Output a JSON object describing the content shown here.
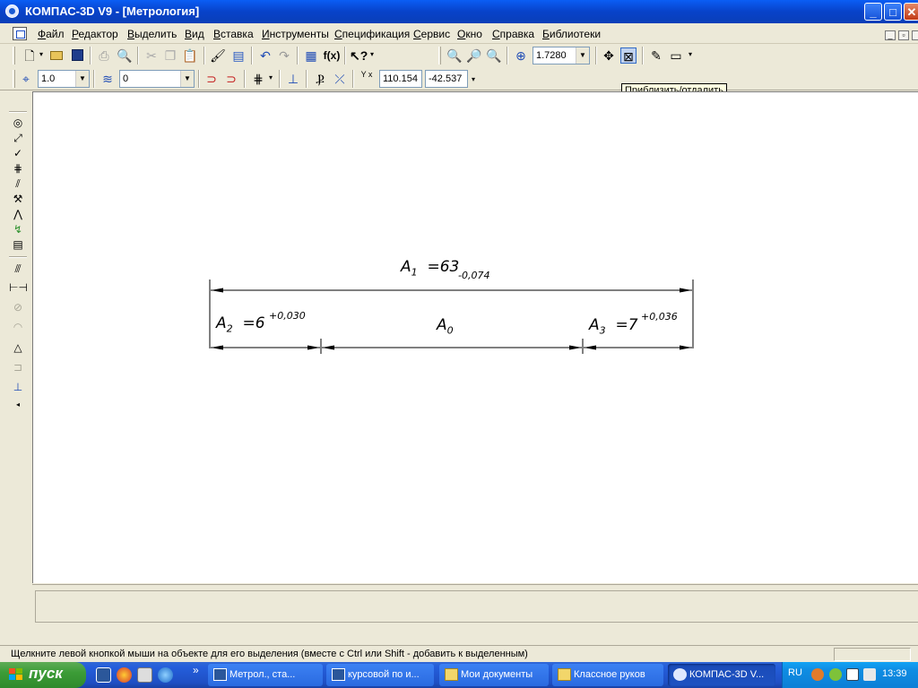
{
  "window": {
    "title": "КОМПАС-3D V9 - [Метрология]",
    "buttons": {
      "minimize": "_",
      "maximize": "□",
      "close": "✕"
    }
  },
  "menu": {
    "items": [
      "Файл",
      "Редактор",
      "Выделить",
      "Вид",
      "Вставка",
      "Инструменты",
      "Спецификация",
      "Сервис",
      "Окно",
      "Справка",
      "Библиотеки"
    ],
    "mdi": {
      "minimize": "_",
      "restore": "▫"
    }
  },
  "toolbar1": {
    "icons": [
      "new-document-icon",
      "open-icon",
      "save-icon",
      "print-icon",
      "print-preview-icon",
      "cut-icon",
      "copy-icon",
      "paste-icon",
      "properties-brush-icon",
      "manager-icon",
      "undo-icon",
      "redo-icon",
      "variables-icon",
      "function-icon",
      "help-pointer-icon",
      "zoom-in-icon",
      "zoom-box-icon",
      "zoom-out-icon",
      "zoom-scale-icon",
      "pan-icon",
      "zoom-fit-icon",
      "draw-settings-icon",
      "view-display-icon"
    ],
    "function_label": "f(x)",
    "zoom_value": "1.7280"
  },
  "toolbar2": {
    "line_scale": "1.0",
    "layer": "0",
    "coord_x_label": "Y x",
    "coord_x": "110.154",
    "coord_y": "-42.537"
  },
  "tooltip": "Приблизить/отдалить",
  "left_toolbar": {
    "icons": [
      "geometry-icon",
      "dimensions-icon",
      "designations-icon",
      "editing-icon",
      "parametrization-icon",
      "measure-icon",
      "select-icon",
      "spec-icon",
      "report-icon",
      "views-icon",
      "dimension-line-icon",
      "disabled-circle-icon",
      "disabled-arc-icon",
      "triangle-icon",
      "disabled-frame-icon",
      "surface-icon",
      "scroll-arrow-icon"
    ]
  },
  "drawing": {
    "a1": {
      "name": "A",
      "sub": "1",
      "value": "=63",
      "tolerance": "-0,074"
    },
    "a2": {
      "name": "A",
      "sub": "2",
      "value": "=6",
      "tolerance": "+0,030"
    },
    "a0": {
      "name": "A",
      "sub": "0"
    },
    "a3": {
      "name": "A",
      "sub": "3",
      "value": "=7",
      "tolerance": "+0,036"
    }
  },
  "status": {
    "message": "Щелкните левой кнопкой мыши на объекте для его выделения (вместе с Ctrl или Shift - добавить к выделенным)"
  },
  "taskbar": {
    "start_label": "пуск",
    "quicklaunch_more": "»",
    "tasks": [
      "Метрол., ста...",
      "курсовой по и...",
      "Мои документы",
      "Классное руков",
      "КОМПАС-3D V..."
    ],
    "lang": "RU",
    "clock": "13:39"
  },
  "colors": {
    "titlebar": "#0842c9",
    "taskbar": "#245edb",
    "start": "#3c9c37",
    "canvas": "#ffffff",
    "tooltip_bg": "#ffffe1"
  }
}
